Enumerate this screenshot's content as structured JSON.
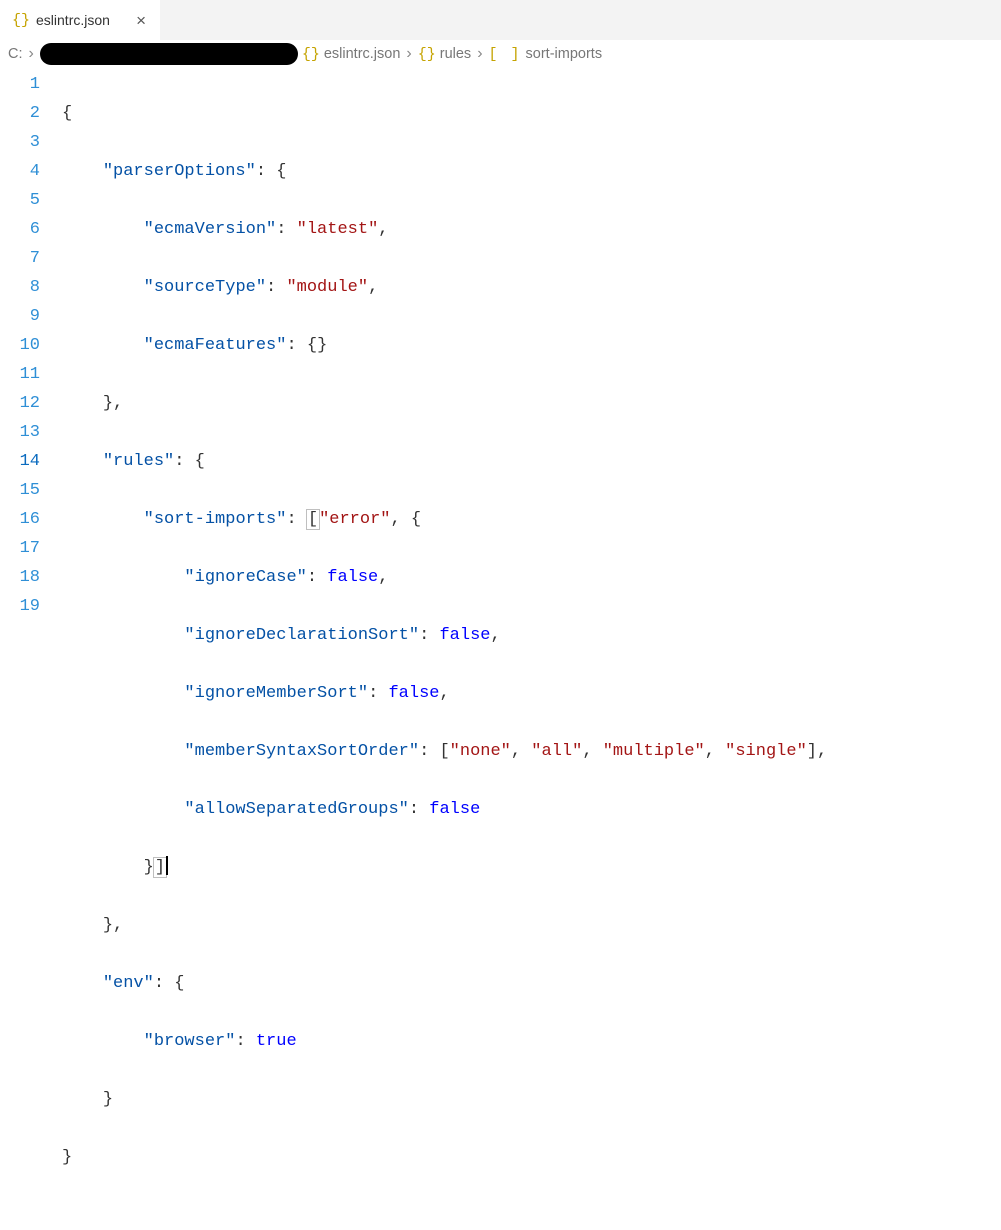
{
  "tab": {
    "filename": "eslintrc.json",
    "icon": "{}",
    "close_glyph": "×"
  },
  "breadcrumbs": {
    "drive": "C:",
    "file_icon": "{}",
    "file": "eslintrc.json",
    "part2_icon": "{}",
    "part2": "rules",
    "part3_icon": "[ ]",
    "part3": "sort-imports"
  },
  "line_numbers": [
    "1",
    "2",
    "3",
    "4",
    "5",
    "6",
    "7",
    "8",
    "9",
    "10",
    "11",
    "12",
    "13",
    "14",
    "15",
    "16",
    "17",
    "18",
    "19"
  ],
  "active_line": "14",
  "code": {
    "l1": {
      "open": "{"
    },
    "l2": {
      "k": "\"parserOptions\"",
      "sep": ": ",
      "open": "{"
    },
    "l3": {
      "k": "\"ecmaVersion\"",
      "sep": ": ",
      "v": "\"latest\"",
      "end": ","
    },
    "l4": {
      "k": "\"sourceType\"",
      "sep": ": ",
      "v": "\"module\"",
      "end": ","
    },
    "l5": {
      "k": "\"ecmaFeatures\"",
      "sep": ": ",
      "open": "{",
      "close": "}"
    },
    "l6": {
      "close": "},",
      "short_close": "}"
    },
    "l7": {
      "k": "\"rules\"",
      "sep": ": ",
      "open": "{"
    },
    "l8": {
      "k": "\"sort-imports\"",
      "sep": ": ",
      "lb": "[",
      "v": "\"error\"",
      "comma": ", ",
      "open": "{"
    },
    "l9": {
      "k": "\"ignoreCase\"",
      "sep": ": ",
      "v": "false",
      "end": ","
    },
    "l10": {
      "k": "\"ignoreDeclarationSort\"",
      "sep": ": ",
      "v": "false",
      "end": ","
    },
    "l11": {
      "k": "\"ignoreMemberSort\"",
      "sep": ": ",
      "v": "false",
      "end": ","
    },
    "l12": {
      "k": "\"memberSyntaxSortOrder\"",
      "sep": ": ",
      "lb": "[",
      "v1": "\"none\"",
      "c1": ", ",
      "v2": "\"all\"",
      "c2": ", ",
      "v3": "\"multiple\"",
      "c3": ", ",
      "v4": "\"single\"",
      "rb": "]",
      "end": ","
    },
    "l13": {
      "k": "\"allowSeparatedGroups\"",
      "sep": ": ",
      "v": "false"
    },
    "l14": {
      "close": "}",
      "rb": "]"
    },
    "l15": {
      "close": "},"
    },
    "l16": {
      "k": "\"env\"",
      "sep": ": ",
      "open": "{"
    },
    "l17": {
      "k": "\"browser\"",
      "sep": ": ",
      "v": "true"
    },
    "l18": {
      "close": "}"
    },
    "l19": {
      "close": "}"
    }
  }
}
